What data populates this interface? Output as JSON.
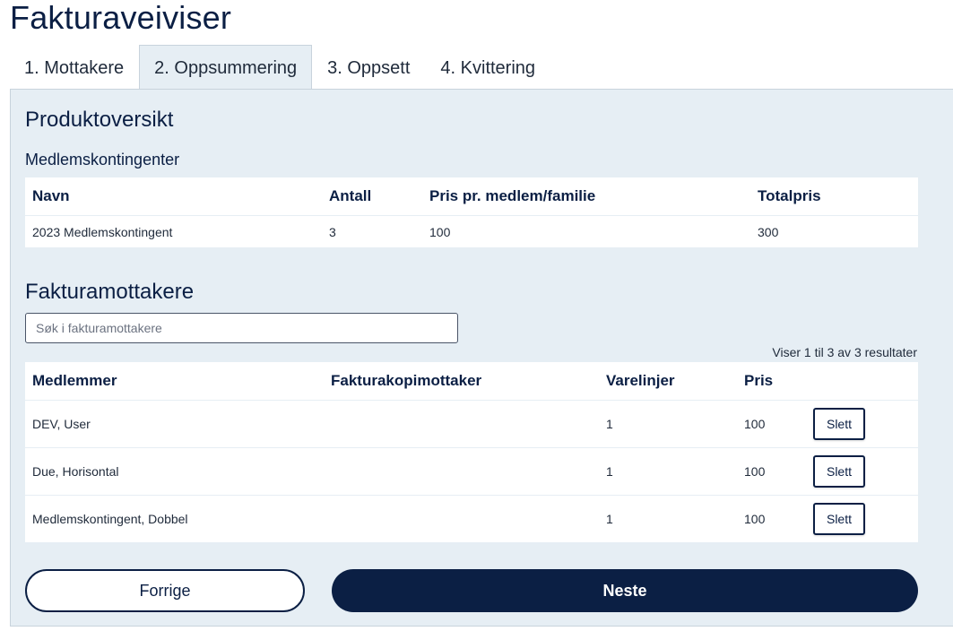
{
  "page_title": "Fakturaveiviser",
  "tabs": [
    {
      "label": "1. Mottakere",
      "active": false
    },
    {
      "label": "2. Oppsummering",
      "active": true
    },
    {
      "label": "3. Oppsett",
      "active": false
    },
    {
      "label": "4. Kvittering",
      "active": false
    }
  ],
  "product_overview": {
    "title": "Produktoversikt",
    "subtitle": "Medlemskontingenter",
    "headers": [
      "Navn",
      "Antall",
      "Pris pr. medlem/familie",
      "Totalpris"
    ],
    "rows": [
      [
        "2023 Medlemskontingent",
        "3",
        "100",
        "300"
      ]
    ]
  },
  "recipients": {
    "title": "Fakturamottakere",
    "search_placeholder": "Søk i fakturamottakere",
    "results_text": "Viser 1 til 3 av 3 resultater",
    "headers": [
      "Medlemmer",
      "Fakturakopimottaker",
      "Varelinjer",
      "Pris"
    ],
    "delete_label": "Slett",
    "rows": [
      [
        "DEV, User",
        "",
        "1",
        "100"
      ],
      [
        "Due, Horisontal",
        "",
        "1",
        "100"
      ],
      [
        "Medlemskontingent, Dobbel",
        "",
        "1",
        "100"
      ]
    ]
  },
  "nav": {
    "prev_label": "Forrige",
    "next_label": "Neste"
  },
  "colors": {
    "primary": "#0b1f44",
    "panel_bg": "#e6eef4"
  }
}
